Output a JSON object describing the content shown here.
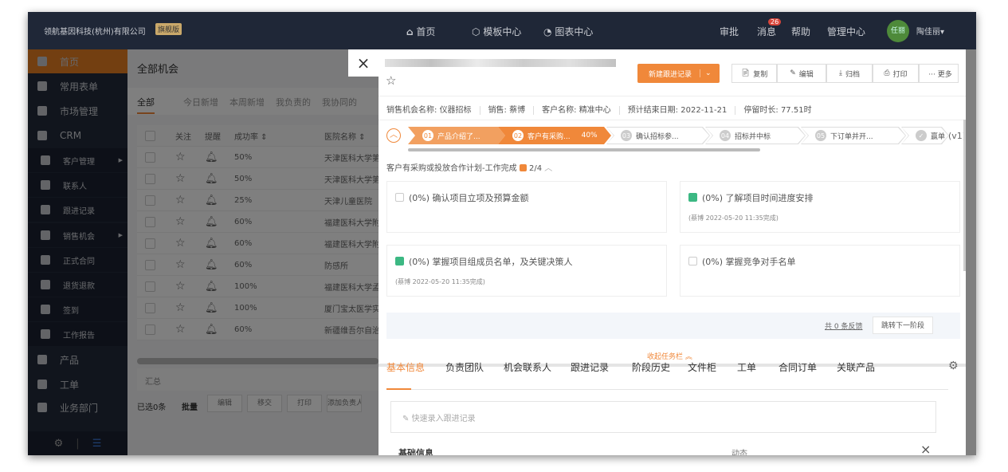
{
  "topbar": {
    "company": "领航基因科技(杭州)有限公司",
    "edition_badge": "旗舰版",
    "nav": [
      {
        "label": "首页",
        "icon": "home-icon"
      },
      {
        "label": "模板中心",
        "icon": "cube-icon"
      },
      {
        "label": "图表中心",
        "icon": "chart-pie-icon"
      }
    ],
    "right": {
      "approve": "审批",
      "messages": "消息",
      "message_count": "26",
      "help": "帮助",
      "admin": "管理中心",
      "avatar": "任丽",
      "user": "陶佳丽▾"
    }
  },
  "sidebar": {
    "items": [
      {
        "label": "首页",
        "active": true
      },
      {
        "label": "常用表单"
      },
      {
        "label": "市场管理"
      },
      {
        "label": "CRM"
      },
      {
        "label": "客户管理",
        "sub": true
      },
      {
        "label": "联系人",
        "sub": true
      },
      {
        "label": "跟进记录",
        "sub": true
      },
      {
        "label": "销售机会",
        "sub": true
      },
      {
        "label": "正式合同",
        "sub": true
      },
      {
        "label": "退货退款",
        "sub": true
      },
      {
        "label": "签到",
        "sub": true
      },
      {
        "label": "工作报告",
        "sub": true
      },
      {
        "label": "产品"
      },
      {
        "label": "工单"
      },
      {
        "label": "业务部门"
      }
    ]
  },
  "list": {
    "title": "全部机会",
    "tabs": [
      "全部",
      "今日新增",
      "本周新增",
      "我负责的",
      "我协同的"
    ],
    "columns": [
      "关注",
      "提醒",
      "成功率 ⇕",
      "医院名称 ⇕"
    ],
    "rows": [
      [
        "50%",
        "天津医科大学第二"
      ],
      [
        "50%",
        "天津医科大学第二"
      ],
      [
        "25%",
        "天津儿童医院"
      ],
      [
        "60%",
        "福建医科大学附属"
      ],
      [
        "60%",
        "福建医科大学附属"
      ],
      [
        "60%",
        "防感所"
      ],
      [
        "100%",
        "福建医科大学孟超"
      ],
      [
        "100%",
        "厦门宝太医学实验"
      ],
      [
        "60%",
        "新疆维吾尔自治区"
      ]
    ],
    "summary": "汇总",
    "selected": "已选0条",
    "batch": "批量",
    "actions": [
      "编辑",
      "移交",
      "打印",
      "添加负责人"
    ]
  },
  "panel": {
    "close": "×",
    "new_record": "新建跟进记录",
    "buttons": [
      "复制",
      "编辑",
      "归档",
      "打印",
      "··· 更多"
    ],
    "info": [
      [
        "销售机会名称:",
        "仪器招标"
      ],
      [
        "销售:",
        "蔡博"
      ],
      [
        "客户名称:",
        "精准中心"
      ],
      [
        "预计结束日期:",
        "2022-11-21"
      ],
      [
        "停留时长:",
        "77.51时"
      ]
    ],
    "stages": [
      {
        "num": "01",
        "label": "产品介绍了..."
      },
      {
        "num": "02",
        "label": "客户有采购...",
        "pct": "40%"
      },
      {
        "num": "03",
        "label": "确认招标参..."
      },
      {
        "num": "04",
        "label": "招标并中标"
      },
      {
        "num": "05",
        "label": "下订单并开..."
      },
      {
        "num": "✓",
        "label": "赢单"
      }
    ],
    "version": "(v1)",
    "task_title": "客户有采购或投放合作计划-工作完成",
    "task_count": "2/4",
    "tasks": [
      {
        "text": "(0%) 确认项目立项及预算金额",
        "done": false,
        "note": ""
      },
      {
        "text": "(0%) 了解项目时间进度安排",
        "done": true,
        "note": "(蔡博 2022-05-20 11:35完成)"
      },
      {
        "text": "(0%) 掌握项目组成员名单，及关键决策人",
        "done": true,
        "note": "(蔡博 2022-05-20 11:35完成)"
      },
      {
        "text": "(0%) 掌握竞争对手名单",
        "done": false,
        "note": ""
      }
    ],
    "feedback": "共 0 条反馈",
    "next_stage": "跳转下一阶段",
    "collapse": "收起任务栏 ︽",
    "tabs": [
      "基本信息",
      "负责团队",
      "机会联系人",
      "跟进记录",
      "阶段历史",
      "文件柜",
      "工单",
      "合同订单",
      "关联产品"
    ],
    "quick_placeholder": "快速录入跟进记录",
    "basic_info": "基础信息",
    "activity": "动态",
    "activity_close": "×"
  },
  "colors": {
    "accent": "#f0883a",
    "nav": "#1f2737",
    "check": "#3cb883"
  }
}
